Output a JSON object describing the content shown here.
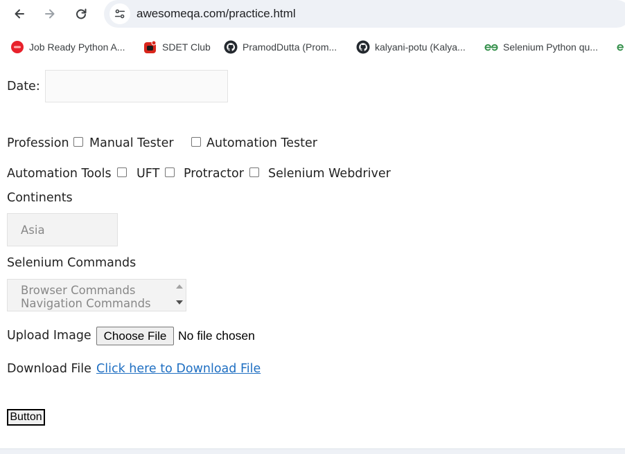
{
  "browser": {
    "url": "awesomeqa.com/practice.html",
    "bookmarks": [
      {
        "label": "Job Ready Python A...",
        "icon": "red-circle-logo-icon"
      },
      {
        "label": "SDET Club",
        "icon": "red-app-icon"
      },
      {
        "label": "PramodDutta (Prom...",
        "icon": "github-icon"
      },
      {
        "label": "kalyani-potu (Kalya...",
        "icon": "github-icon"
      },
      {
        "label": "Selenium Python qu...",
        "icon": "geeksforgeeks-icon"
      }
    ]
  },
  "form": {
    "date_label": "Date:",
    "profession_label": "Profession",
    "profession_options": [
      "Manual Tester",
      "Automation Tester"
    ],
    "tools_label": "Automation Tools",
    "tools_options": [
      "UFT",
      "Protractor",
      "Selenium Webdriver"
    ],
    "continents_label": "Continents",
    "continents_selected": "Asia",
    "commands_label": "Selenium Commands",
    "commands_options": [
      "Browser Commands",
      "Navigation Commands"
    ],
    "upload_label": "Upload Image",
    "choose_file_label": "Choose File",
    "no_file_text": "No file chosen",
    "download_label": "Download File",
    "download_link_text": "Click here to Download File",
    "button_label": "Button"
  },
  "colors": {
    "link": "#1f6fc2",
    "omnibox_bg": "#eef1f6"
  }
}
